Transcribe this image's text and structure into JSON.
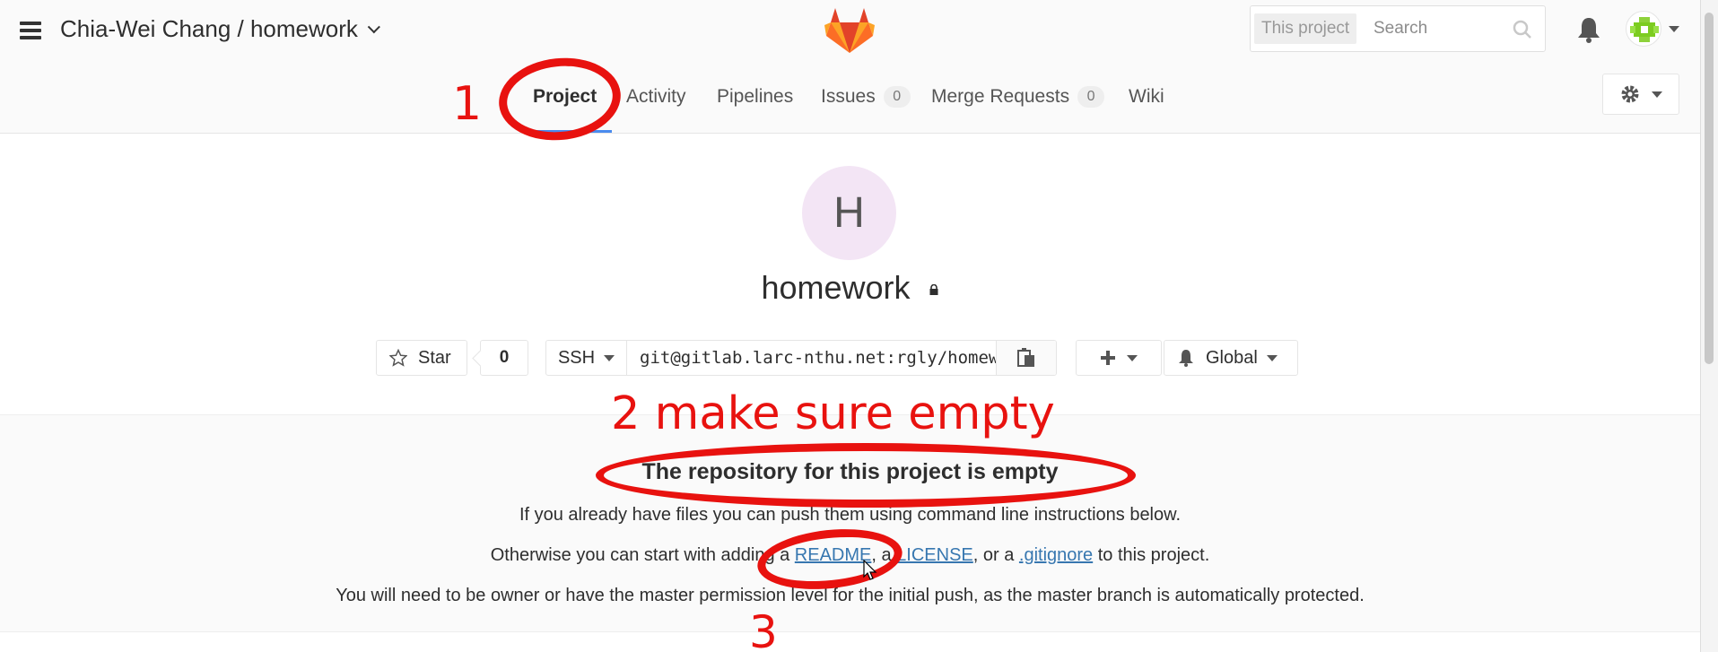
{
  "header": {
    "title": "Chia-Wei Chang / homework",
    "search_scope": "This project",
    "search_placeholder": "Search"
  },
  "nav": {
    "items": [
      {
        "label": "Project"
      },
      {
        "label": "Activity"
      },
      {
        "label": "Pipelines"
      },
      {
        "label": "Issues",
        "count": "0"
      },
      {
        "label": "Merge Requests",
        "count": "0"
      },
      {
        "label": "Wiki"
      }
    ]
  },
  "project": {
    "avatar_letter": "H",
    "name": "homework",
    "star_label": "Star",
    "star_count": "0",
    "clone_protocol": "SSH",
    "clone_url": "git@gitlab.larc-nthu.net:rgly/homework.git",
    "notification_label": "Global"
  },
  "empty_state": {
    "title": "The repository for this project is empty",
    "line1": "If you already have files you can push them using command line instructions below.",
    "line2_prefix": "Otherwise you can start with adding a ",
    "readme_link": "README",
    "sep1": ", a ",
    "license_link": "LICENSE",
    "sep2": ", or a ",
    "gitignore_link": ".gitignore",
    "line2_suffix": " to this project.",
    "line3": "You will need to be owner or have the master permission level for the initial push, as the master branch is automatically protected."
  },
  "annotations": {
    "step1": "1",
    "step2": "2 make sure empty",
    "step3": "3",
    "color": "#e8120f"
  },
  "colors": {
    "link": "#3777b0",
    "nav_active_underline": "#4a8bee",
    "avatar_bg": "#f3e5f5"
  }
}
